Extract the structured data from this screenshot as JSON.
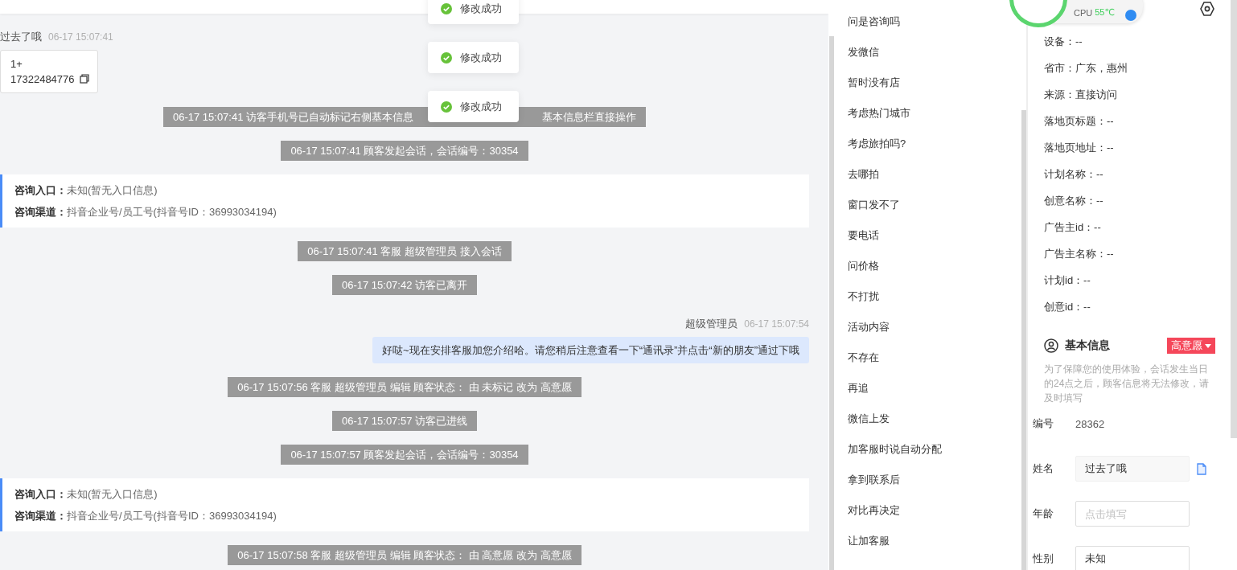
{
  "toasts": [
    {
      "text": "修改成功"
    },
    {
      "text": "修改成功"
    },
    {
      "text": "修改成功"
    }
  ],
  "chat": [
    {
      "kind": "visitor",
      "name": "过去了哦",
      "time": "06-17 15:07:41",
      "text": "1+ 17322484776"
    },
    {
      "kind": "system",
      "parts": [
        "06-17 15:07:41 访客手机号已自动标记右侧基本信息",
        "基本信息栏直接操作"
      ]
    },
    {
      "kind": "system",
      "parts": [
        "06-17 15:07:41 顾客发起会话，会话编号：30354"
      ]
    },
    {
      "kind": "info",
      "lines": [
        "**咨询入口：**未知(暂无入口信息)",
        "**咨询渠道：**抖音企业号/员工号(抖音号ID：36993034194)"
      ]
    },
    {
      "kind": "system",
      "parts": [
        "06-17 15:07:41 客服 超级管理员 接入会话"
      ]
    },
    {
      "kind": "system",
      "parts": [
        "06-17 15:07:42 访客已离开"
      ]
    },
    {
      "kind": "agent",
      "name": "超级管理员",
      "time": "06-17 15:07:54",
      "text": "好哒~现在安排客服加您介绍哈。请您稍后注意查看一下“通讯录”并点击“新的朋友”通过下哦"
    },
    {
      "kind": "system",
      "parts": [
        "06-17 15:07:56 客服 超级管理员 编辑 顾客状态： 由 未标记 改为 高意愿"
      ]
    },
    {
      "kind": "system",
      "parts": [
        "06-17 15:07:57 访客已进线"
      ]
    },
    {
      "kind": "system",
      "parts": [
        "06-17 15:07:57 顾客发起会话，会话编号：30354"
      ]
    },
    {
      "kind": "info",
      "lines": [
        "**咨询入口：**未知(暂无入口信息)",
        "**咨询渠道：**抖音企业号/员工号(抖音号ID：36993034194)"
      ]
    },
    {
      "kind": "system",
      "parts": [
        "06-17 15:07:58 客服 超级管理员 编辑 顾客状态： 由 高意愿 改为 高意愿"
      ]
    }
  ],
  "quick_replies": [
    "问是咨询吗",
    "发微信",
    "暂时没有店",
    "考虑热门城市",
    "考虑旅拍吗?",
    "去哪拍",
    "窗口发不了",
    "要电话",
    "问价格",
    "不打扰",
    "活动内容",
    "不存在",
    "再追",
    "微信上发",
    "加客服时说自动分配",
    "拿到联系后",
    "对比再决定",
    "让加客服"
  ],
  "monitor": {
    "label": "CPU",
    "temp": "55℃"
  },
  "visitor_info": [
    "设备：--",
    "省市：广东，惠州",
    "来源：直接访问",
    "落地页标题：--",
    "落地页地址：--",
    "计划名称：--",
    "创意名称：--",
    "广告主id：--",
    "广告主名称：--",
    "计划id：--",
    "创意id：--"
  ],
  "basic_info": {
    "title": "基本信息",
    "intent": "高意愿",
    "notice": "为了保障您的使用体验，会话发生当日的24点之后，顾客信息将无法修改，请及时填写",
    "fields": [
      {
        "kind": "static",
        "label": "编号",
        "value": "28362"
      },
      {
        "kind": "input",
        "label": "姓名",
        "value": "过去了哦",
        "readonly": true,
        "copy": true
      },
      {
        "kind": "input",
        "label": "年龄",
        "placeholder": "点击填写",
        "readonly": false,
        "copy": false
      },
      {
        "kind": "input",
        "label": "性别",
        "value": "未知",
        "readonly": false,
        "copy": false
      }
    ]
  }
}
